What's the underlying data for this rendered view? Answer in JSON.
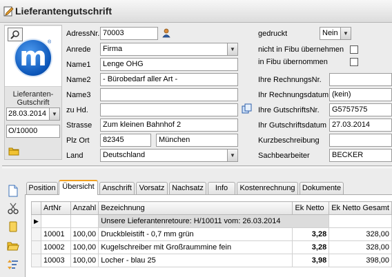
{
  "window": {
    "title": "Lieferantengutschrift"
  },
  "left_panel": {
    "doc_label_line1": "Lieferanten-",
    "doc_label_line2": "Gutschrift",
    "date": "28.03.2014",
    "number": "O/10000"
  },
  "form": {
    "adressnr": {
      "label": "AdressNr.",
      "value": "70003"
    },
    "anrede": {
      "label": "Anrede",
      "value": "Firma"
    },
    "name1": {
      "label": "Name1",
      "value": "Lenge OHG"
    },
    "name2": {
      "label": "Name2",
      "value": "- Bürobedarf aller Art -"
    },
    "name3": {
      "label": "Name3",
      "value": ""
    },
    "zuhd": {
      "label": "zu Hd.",
      "value": ""
    },
    "strasse": {
      "label": "Strasse",
      "value": "Zum kleinen Bahnhof 2"
    },
    "plz_ort": {
      "label": "Plz  Ort",
      "plz": "82345",
      "ort": "München"
    },
    "land": {
      "label": "Land",
      "value": "Deutschland"
    },
    "gedruckt": {
      "label": "gedruckt",
      "value": "Nein"
    },
    "nicht_fibu": {
      "label": "nicht in Fibu übernehmen"
    },
    "in_fibu": {
      "label": "in Fibu übernommen"
    },
    "rechnungsnr": {
      "label": "Ihre RechnungsNr.",
      "value": ""
    },
    "rechnungsdatum": {
      "label": "Ihr Rechnungsdatum",
      "value": "(kein)"
    },
    "gutschriftsnr": {
      "label": "Ihre GutschriftsNr.",
      "value": "G5757575"
    },
    "gutschriftsdatum": {
      "label": "Ihr Gutschriftsdatum",
      "value": "27.03.2014"
    },
    "kurzbeschreibung": {
      "label": "Kurzbeschreibung",
      "value": ""
    },
    "sachbearbeiter": {
      "label": "Sachbearbeiter",
      "value": "BECKER"
    }
  },
  "tabs": [
    {
      "label": "Position"
    },
    {
      "label": "Übersicht"
    },
    {
      "label": "Anschrift"
    },
    {
      "label": "Vorsatz"
    },
    {
      "label": "Nachsatz"
    },
    {
      "label": "Info"
    },
    {
      "label": "Kostenrechnung"
    },
    {
      "label": "Dokumente"
    }
  ],
  "active_tab": "Übersicht",
  "grid": {
    "columns": [
      "ArtNr",
      "Anzahl",
      "Bezeichnung",
      "Ek Netto",
      "Ek Netto Gesamt"
    ],
    "header_row": "Unsere Lieferantenretoure: H/10011 vom: 26.03.2014",
    "rows": [
      {
        "artnr": "10001",
        "anzahl": "100,00",
        "bez": "Druckbleistift - 0,7 mm  grün",
        "ek": "3,28",
        "gesamt": "328,00"
      },
      {
        "artnr": "10002",
        "anzahl": "100,00",
        "bez": "Kugelschreiber mit Großraummine fein",
        "ek": "3,28",
        "gesamt": "328,00"
      },
      {
        "artnr": "10003",
        "anzahl": "100,00",
        "bez": "Locher - blau 25",
        "ek": "3,98",
        "gesamt": "398,00"
      }
    ]
  },
  "icons": {
    "title": "edit-document-icon",
    "zoom": "zoom-icon",
    "address_lookup": "person-icon",
    "copy": "copy-icon",
    "folder": "folder-icon",
    "toolbar": [
      "new-document-icon",
      "cut-icon",
      "note-icon",
      "folders-icon",
      "sort-icon"
    ]
  }
}
